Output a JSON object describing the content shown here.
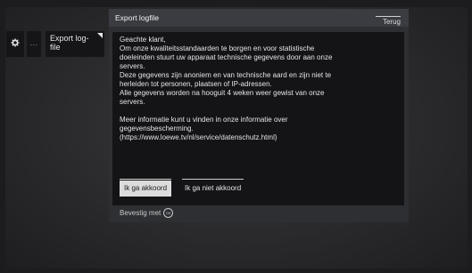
{
  "menu": {
    "settings_icon": "gear-icon",
    "more_label": "···",
    "export_tile_label": "Export log-file"
  },
  "dialog": {
    "title": "Export logfile",
    "back_label": "Terug",
    "body_lines": [
      "Geachte klant,",
      "Om onze kwaliteitsstandaarden te borgen en voor statistische",
      "doeleinden stuurt uw apparaat technische gegevens door aan onze",
      "servers.",
      "Deze gegevens zijn anoniem en van technische aard en zijn niet te",
      "herleiden tot personen, plaatsen of IP-adressen.",
      "Alle gegevens worden na hooguit 4 weken weer gewist van onze",
      "servers.",
      "",
      "Meer informatie kunt u vinden in onze informatie over",
      "gegevensbescherming.",
      "(https://www.loewe.tv/nl/service/datenschutz.html)"
    ],
    "accept_label": "Ik ga akkoord",
    "decline_label": "Ik ga niet akkoord",
    "footer_label": "Bevestig met",
    "footer_icon": "ok-button-icon",
    "footer_icon_text": "OK"
  }
}
